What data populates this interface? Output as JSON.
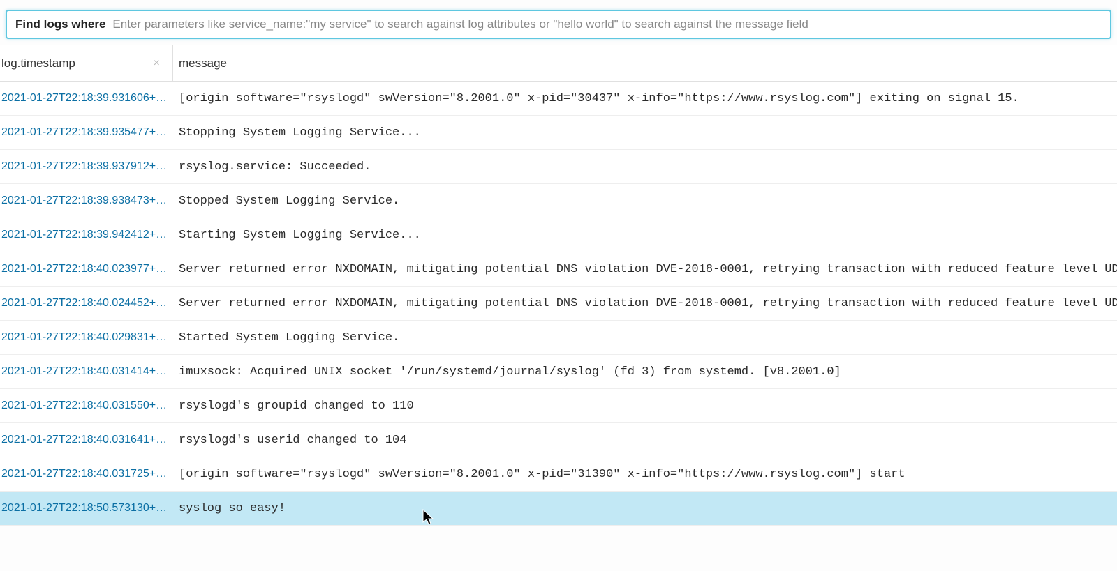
{
  "search": {
    "label": "Find logs where",
    "placeholder": "Enter parameters like service_name:\"my service\" to search against log attributes or \"hello world\" to search against the message field",
    "value": ""
  },
  "columns": {
    "timestamp": "log.timestamp",
    "message": "message",
    "clear_symbol": "×"
  },
  "logs": [
    {
      "ts": "2021-01-27T22:18:39.931606+…",
      "msg": "[origin software=\"rsyslogd\" swVersion=\"8.2001.0\" x-pid=\"30437\" x-info=\"https://www.rsyslog.com\"] exiting on signal 15.",
      "highlighted": false
    },
    {
      "ts": "2021-01-27T22:18:39.935477+…",
      "msg": "Stopping System Logging Service...",
      "highlighted": false
    },
    {
      "ts": "2021-01-27T22:18:39.937912+…",
      "msg": "rsyslog.service: Succeeded.",
      "highlighted": false
    },
    {
      "ts": "2021-01-27T22:18:39.938473+…",
      "msg": "Stopped System Logging Service.",
      "highlighted": false
    },
    {
      "ts": "2021-01-27T22:18:39.942412+…",
      "msg": "Starting System Logging Service...",
      "highlighted": false
    },
    {
      "ts": "2021-01-27T22:18:40.023977+…",
      "msg": "Server returned error NXDOMAIN, mitigating potential DNS violation DVE-2018-0001, retrying transaction with reduced feature level UDP.",
      "highlighted": false
    },
    {
      "ts": "2021-01-27T22:18:40.024452+…",
      "msg": "Server returned error NXDOMAIN, mitigating potential DNS violation DVE-2018-0001, retrying transaction with reduced feature level UDP.",
      "highlighted": false
    },
    {
      "ts": "2021-01-27T22:18:40.029831+…",
      "msg": "Started System Logging Service.",
      "highlighted": false
    },
    {
      "ts": "2021-01-27T22:18:40.031414+…",
      "msg": "imuxsock: Acquired UNIX socket '/run/systemd/journal/syslog' (fd 3) from systemd. [v8.2001.0]",
      "highlighted": false
    },
    {
      "ts": "2021-01-27T22:18:40.031550+…",
      "msg": "rsyslogd's groupid changed to 110",
      "highlighted": false
    },
    {
      "ts": "2021-01-27T22:18:40.031641+…",
      "msg": "rsyslogd's userid changed to 104",
      "highlighted": false
    },
    {
      "ts": "2021-01-27T22:18:40.031725+…",
      "msg": "[origin software=\"rsyslogd\" swVersion=\"8.2001.0\" x-pid=\"31390\" x-info=\"https://www.rsyslog.com\"] start",
      "highlighted": false
    },
    {
      "ts": "2021-01-27T22:18:50.573130+…",
      "msg": "syslog so easy!",
      "highlighted": true
    }
  ]
}
